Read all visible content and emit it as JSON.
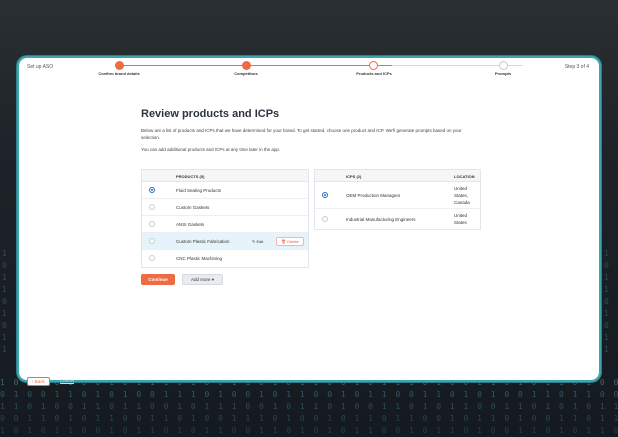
{
  "header": {
    "setup_label": "Set up ASO",
    "step_counter": "Step 3 of 4",
    "steps": [
      {
        "label": "Confirm brand details",
        "state": "done"
      },
      {
        "label": "Competitors",
        "state": "done"
      },
      {
        "label": "Products and ICPs",
        "state": "current"
      },
      {
        "label": "Prompts",
        "state": "todo"
      }
    ]
  },
  "main": {
    "title": "Review products and ICPs",
    "description": "Below are a list of products and ICPs that we have determined for your brand. To get started, choose one product and ICP. We'll generate prompts based on your selection.",
    "note": "You can add additional products and ICPs at any time later in the app."
  },
  "products": {
    "header": "PRODUCTS (5)",
    "rows": [
      {
        "name": "Fluid Sealing Products",
        "selected": true
      },
      {
        "name": "Custom Gaskets",
        "selected": false
      },
      {
        "name": "ANSI Gaskets",
        "selected": false
      },
      {
        "name": "Custom Plastic Fabrication",
        "selected": false,
        "hovered": true
      },
      {
        "name": "CNC Plastic Machining",
        "selected": false
      }
    ],
    "edit_label": "Edit",
    "delete_label": "Delete"
  },
  "icps": {
    "header": "ICPS (2)",
    "location_header": "LOCATION",
    "rows": [
      {
        "name": "OEM Production Managers",
        "location": [
          "United",
          "States,",
          "Canada"
        ],
        "selected": true
      },
      {
        "name": "Industrial Manufacturing Engineers",
        "location": [
          "United",
          "States"
        ],
        "selected": false
      }
    ]
  },
  "actions": {
    "continue_label": "Continue",
    "add_more_label": "Add more ▾"
  },
  "footer": {
    "back_label": "‹ Back",
    "cancel_label": "Cancel"
  },
  "colors": {
    "accent": "#f06a43",
    "selected_radio": "#2f6fb3",
    "card_border": "#3aa7b0",
    "hover_row": "#e6f3fa"
  }
}
